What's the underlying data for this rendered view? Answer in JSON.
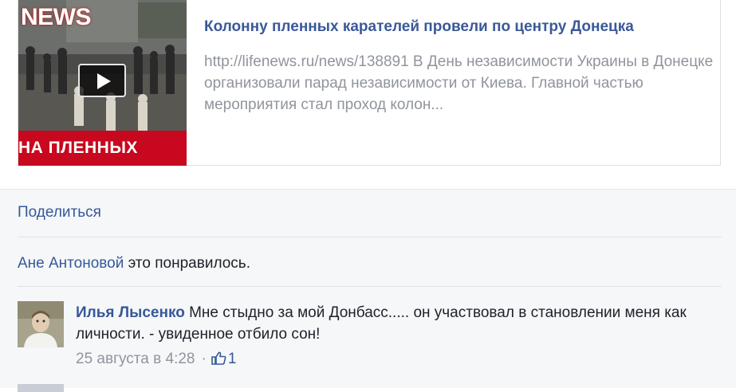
{
  "link_preview": {
    "thumbnail": {
      "brand_text": "NEWS",
      "banner_text": "НА ПЛЕННЫХ",
      "play_icon": "play-icon"
    },
    "title": "Колонну пленных карателей провели по центру Донецка",
    "description": "http://lifenews.ru/news/138891 В День независимости Украины в Донецке организовали парад независимости от Киева. Главной частью мероприятия стал проход колон..."
  },
  "actions": {
    "share_label": "Поделиться"
  },
  "likes": {
    "user": "Ане Антоновой",
    "suffix": " это понравилось."
  },
  "comment": {
    "author": "Илья Лысенко",
    "text": " Мне стыдно за мой Донбасс..... он участвовал в становлении меня как личности. - увиденное отбило сон!",
    "timestamp": "25 августа в 4:28",
    "separator": "·",
    "like_count": "1",
    "like_icon": "thumbs-up-icon"
  },
  "colors": {
    "link": "#365899",
    "title": "#3b5998",
    "muted": "#90949c",
    "banner": "#c8081e",
    "footer_bg": "#f6f7f9"
  }
}
